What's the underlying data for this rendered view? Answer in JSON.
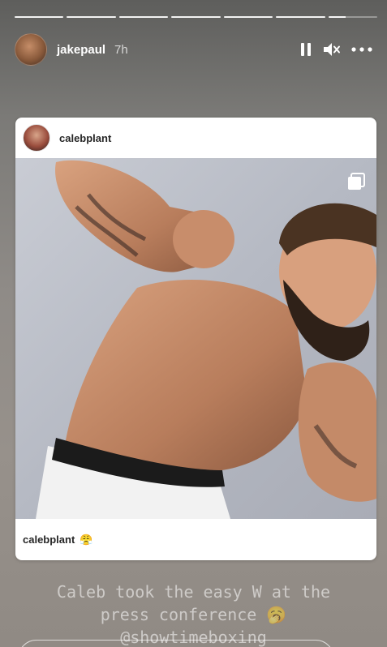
{
  "story": {
    "segments": 7,
    "current_segment": 7,
    "current_progress": 0.35
  },
  "header": {
    "username": "jakepaul",
    "time": "7h",
    "icons": [
      "pause-icon",
      "mute-icon",
      "more-icon"
    ]
  },
  "post": {
    "username": "calebplant",
    "caption_user": "calebplant",
    "caption_emoji": "😤",
    "multi_icon": "carousel-icon"
  },
  "text_overlay": {
    "line1": "Caleb took the easy W at the",
    "line2": "press conference 🥱",
    "line3": "@showtimeboxing"
  }
}
